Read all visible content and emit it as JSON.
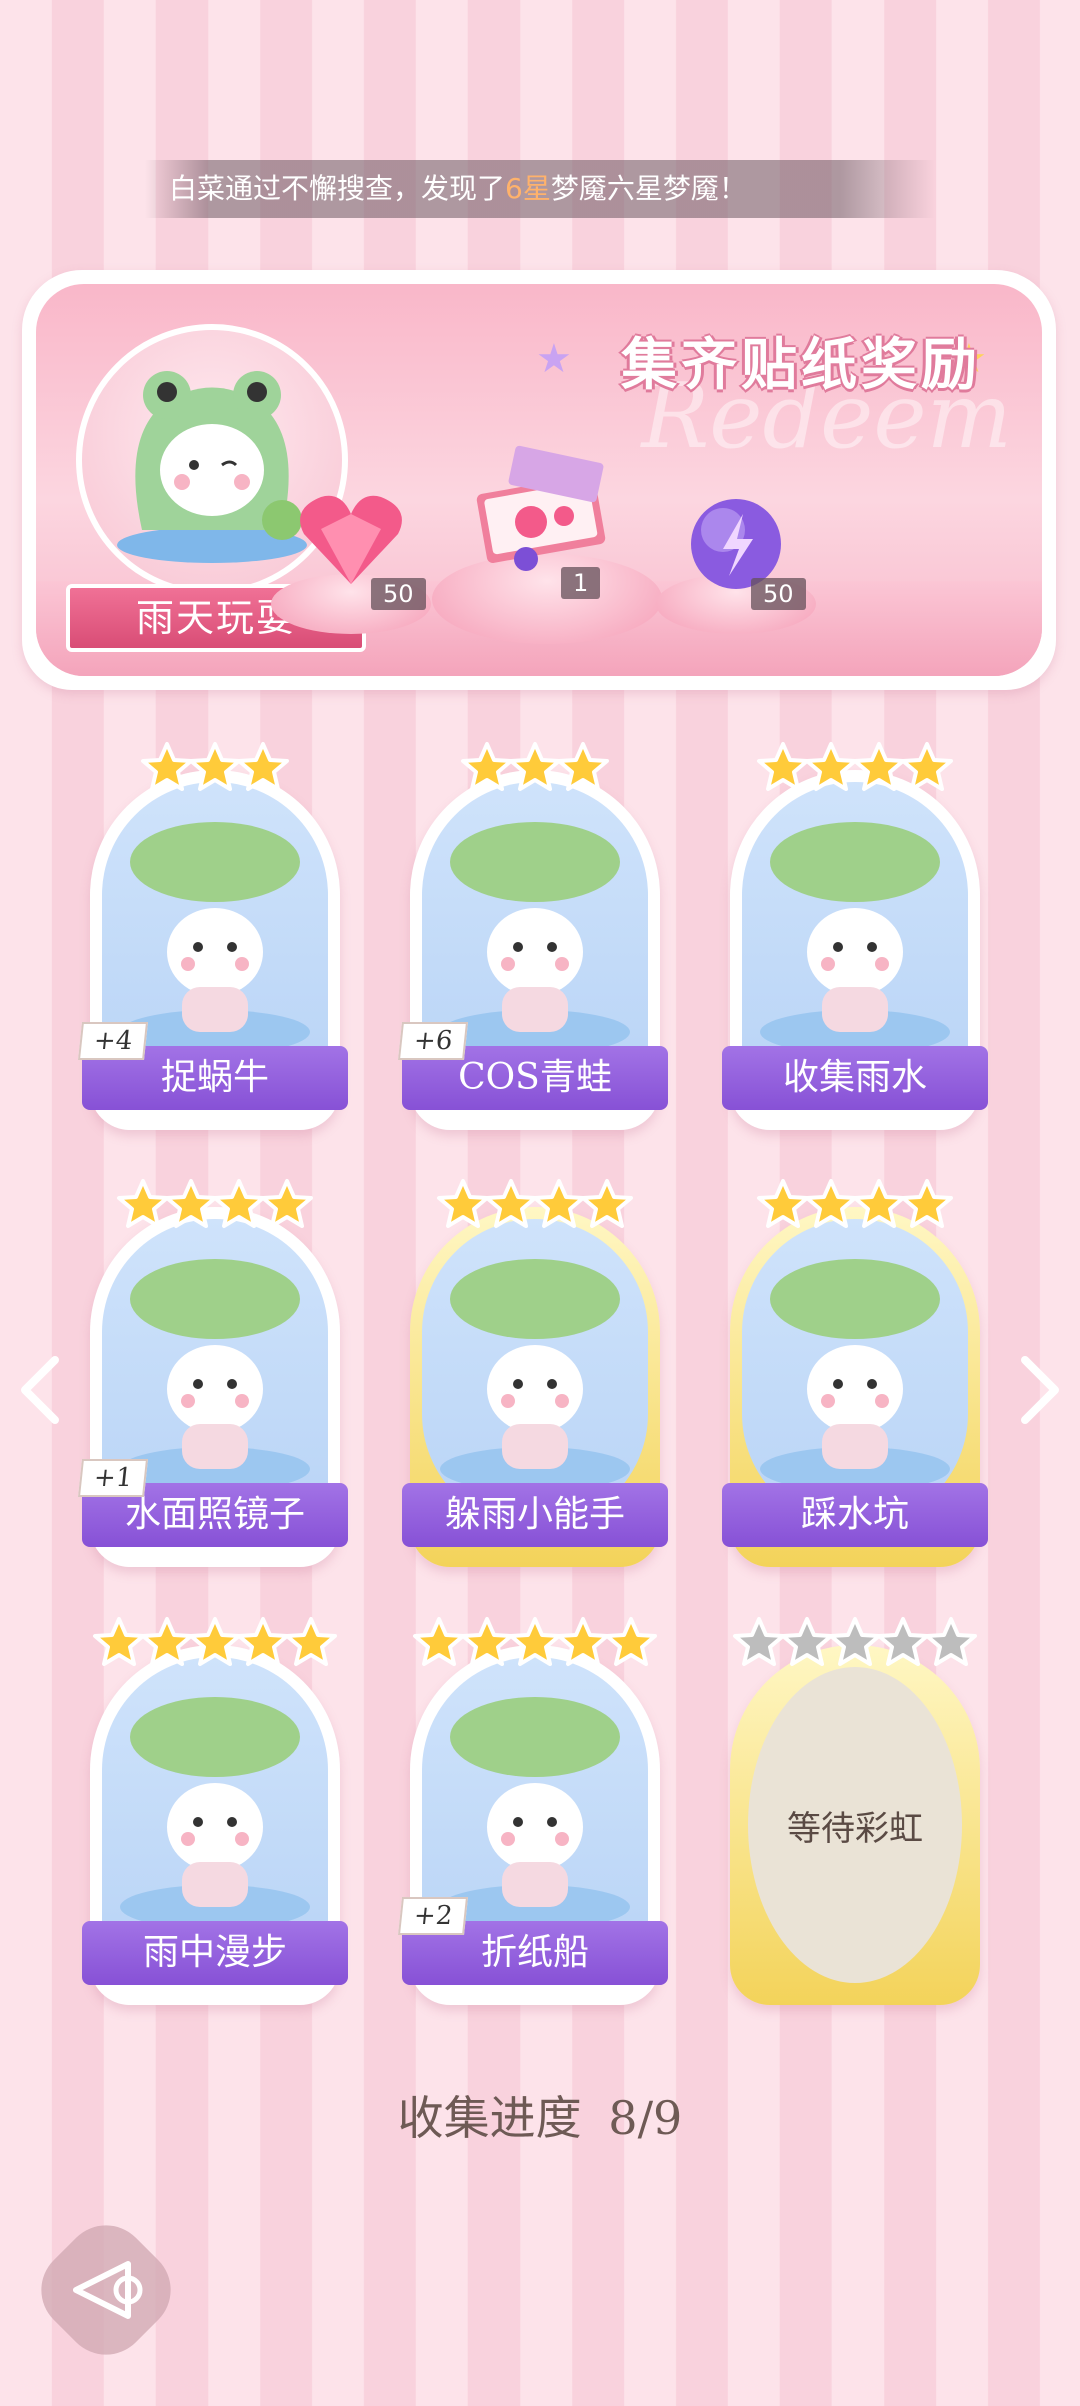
{
  "notice": {
    "prefix": "白菜通过不懈搜查，发现了",
    "highlight": "6星",
    "suffix": "梦魇六星梦魇！"
  },
  "banner": {
    "title": "集齐贴纸奖励",
    "watermark": "Redeem",
    "theme_label": "雨天玩耍",
    "rewards": [
      {
        "icon": "heart-gem-icon",
        "count": "50"
      },
      {
        "icon": "gift-box-icon",
        "count": "1"
      },
      {
        "icon": "energy-orb-icon",
        "count": "50"
      }
    ]
  },
  "cards": [
    {
      "label": "捉蜗牛",
      "stars": 3,
      "plus": "+4",
      "icon": "puppy-leaf-icon"
    },
    {
      "label": "COS青蛙",
      "stars": 3,
      "plus": "+6",
      "icon": "frog-costume-icon"
    },
    {
      "label": "收集雨水",
      "stars": 4,
      "plus": "",
      "icon": "cat-leaf-icon"
    },
    {
      "label": "水面照镜子",
      "stars": 4,
      "plus": "+1",
      "icon": "cat-reflection-icon"
    },
    {
      "label": "躲雨小能手",
      "stars": 4,
      "plus": "",
      "icon": "bunny-frog-icon"
    },
    {
      "label": "踩水坑",
      "stars": 4,
      "plus": "",
      "icon": "girl-umbrella-icon"
    },
    {
      "label": "雨中漫步",
      "stars": 5,
      "plus": "",
      "icon": "cat-raincoat-icon"
    },
    {
      "label": "折纸船",
      "stars": 5,
      "plus": "+2",
      "icon": "duck-bear-icon"
    },
    {
      "label": "等待彩虹",
      "stars": 5,
      "plus": "",
      "icon": "locked-card"
    }
  ],
  "progress": {
    "label": "收集进度",
    "value": "8/9"
  }
}
